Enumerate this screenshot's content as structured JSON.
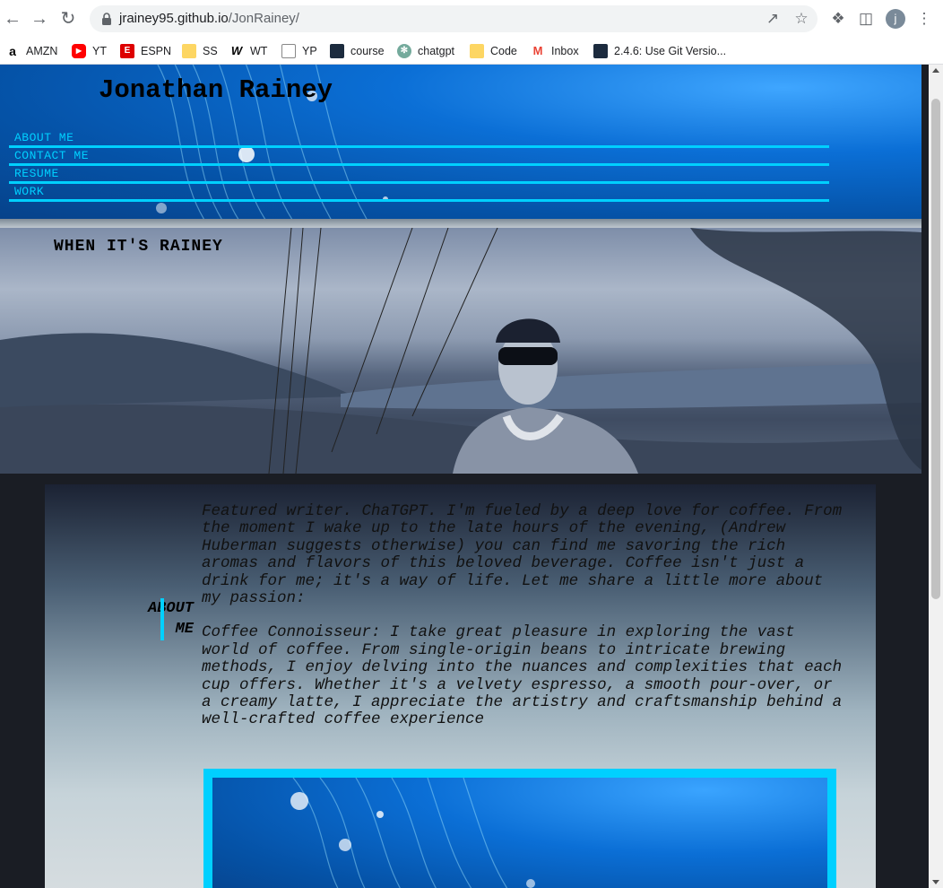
{
  "browser": {
    "url_host": "jrainey95.github.io",
    "url_path": "/JonRainey/",
    "profile_initial": "j",
    "bookmarks": [
      {
        "label": "AMZN",
        "icon": "amazon-icon"
      },
      {
        "label": "YT",
        "icon": "youtube-icon"
      },
      {
        "label": "ESPN",
        "icon": "espn-icon"
      },
      {
        "label": "SS",
        "icon": "folder-icon"
      },
      {
        "label": "WT",
        "icon": "wt-icon"
      },
      {
        "label": "YP",
        "icon": "page-icon"
      },
      {
        "label": "course",
        "icon": "course-icon"
      },
      {
        "label": "chatgpt",
        "icon": "chatgpt-icon"
      },
      {
        "label": "Code",
        "icon": "folder-icon"
      },
      {
        "label": "Inbox",
        "icon": "gmail-icon"
      },
      {
        "label": "2.4.6: Use Git Versio...",
        "icon": "course-icon"
      }
    ]
  },
  "header": {
    "title": "Jonathan Rainey",
    "nav": [
      "ABOUT ME",
      "CONTACT ME",
      "RESUME",
      "WORK"
    ]
  },
  "hero": {
    "title": "WHEN IT'S RAINEY"
  },
  "about": {
    "label_line1": "ABOUT",
    "label_line2": "ME",
    "paragraph1": "Featured writer. ChaTGPT. I'm fueled by a deep love for coffee. From the moment I wake up to the late hours of the evening, (Andrew Huberman suggests otherwise) you can find me savoring the rich aromas and flavors of this beloved beverage. Coffee isn't just a drink for me; it's a way of life. Let me share a little more about my passion:",
    "paragraph2": "Coffee Connoisseur: I take great pleasure in exploring the vast world of coffee. From single-origin beans to intricate brewing methods, I enjoy delving into the nuances and complexities that each cup offers. Whether it's a velvety espresso, a smooth pour-over, or a creamy latte, I appreciate the artistry and craftsmanship behind a well-crafted coffee experience"
  },
  "colors": {
    "accent": "#00d0ff",
    "header_blue": "#0b6fd6"
  }
}
